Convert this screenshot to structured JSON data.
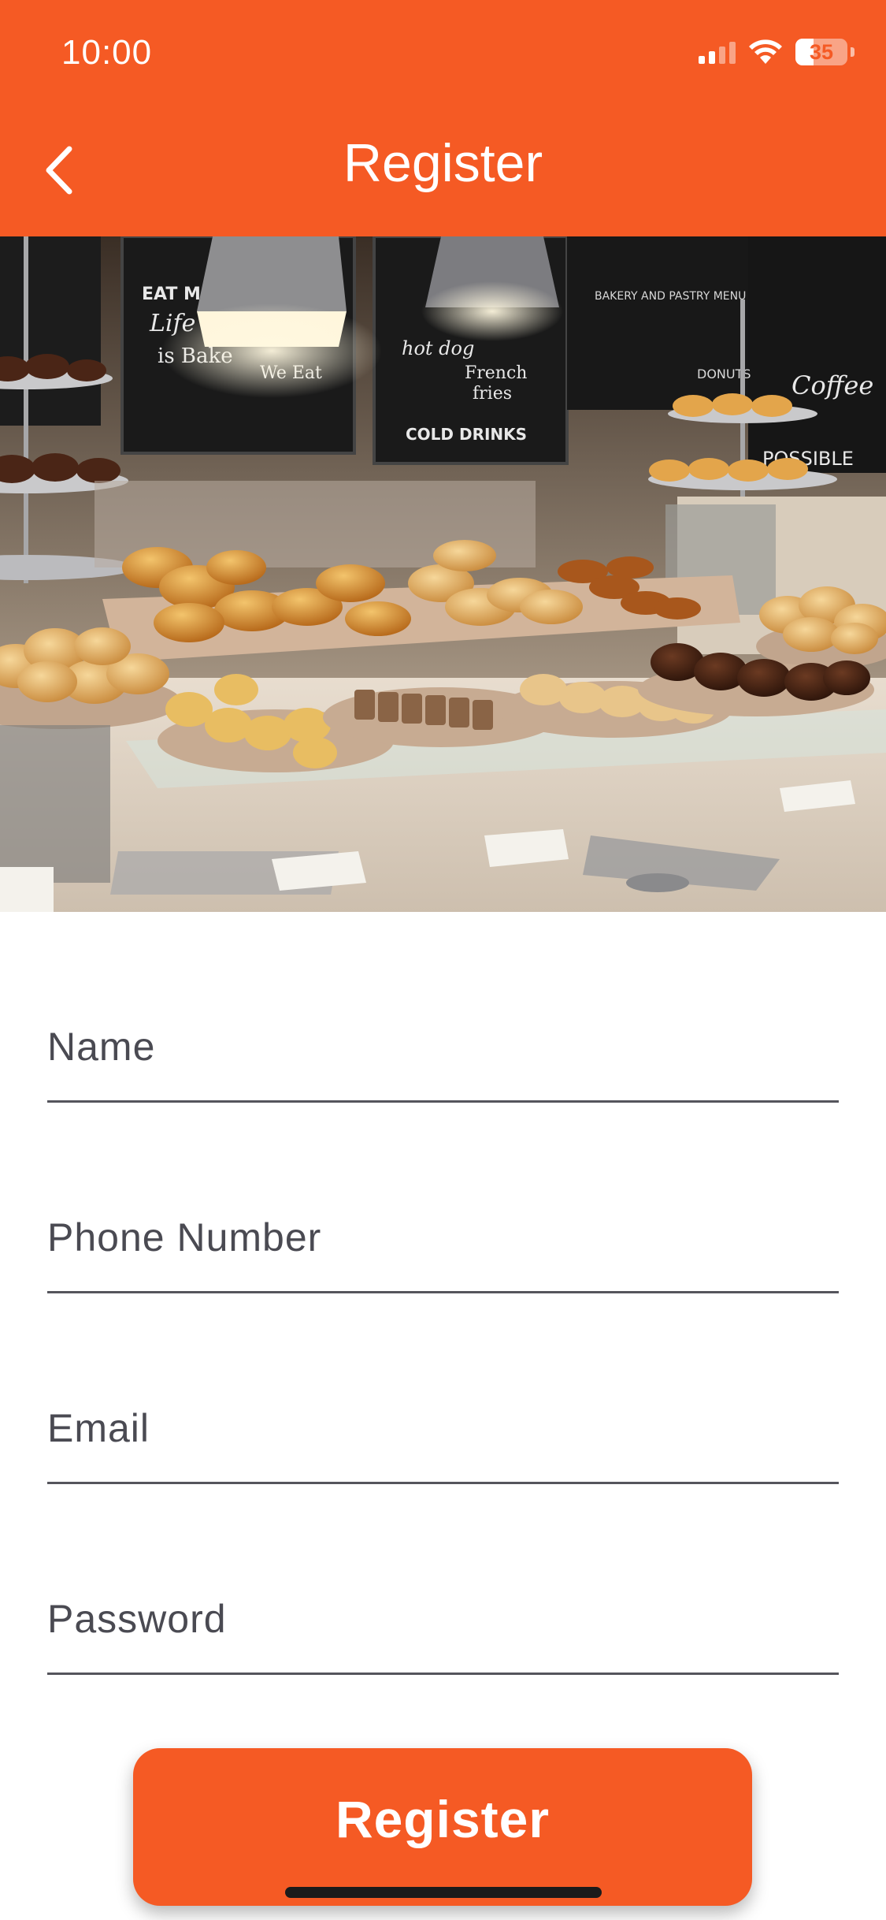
{
  "status_bar": {
    "time": "10:00",
    "battery": "35",
    "battery_level": 0.35,
    "icons": [
      "cellular-signal-icon",
      "wifi-icon",
      "battery-icon"
    ]
  },
  "header": {
    "title": "Register",
    "back_icon": "chevron-left-icon",
    "color": "#f55a24"
  },
  "hero": {
    "description_icon": "bakery-buffet-photo",
    "chalkboard_text": [
      "hot dog",
      "French fries",
      "DRINKS",
      "Life is Bake IT you",
      "EAT Meet",
      "We Eat Coffee for BREAKFAST",
      "Coffee",
      "EVERYTHING POSSIBLE",
      "BAKERY AND PASTRY MENU",
      "DONUTS"
    ]
  },
  "form": {
    "name_placeholder": "Name",
    "phone_placeholder": "Phone Number",
    "email_placeholder": "Email",
    "password_placeholder": "Password"
  },
  "actions": {
    "register_label": "Register"
  },
  "colors": {
    "accent": "#f55a24",
    "underline": "#55555c"
  }
}
